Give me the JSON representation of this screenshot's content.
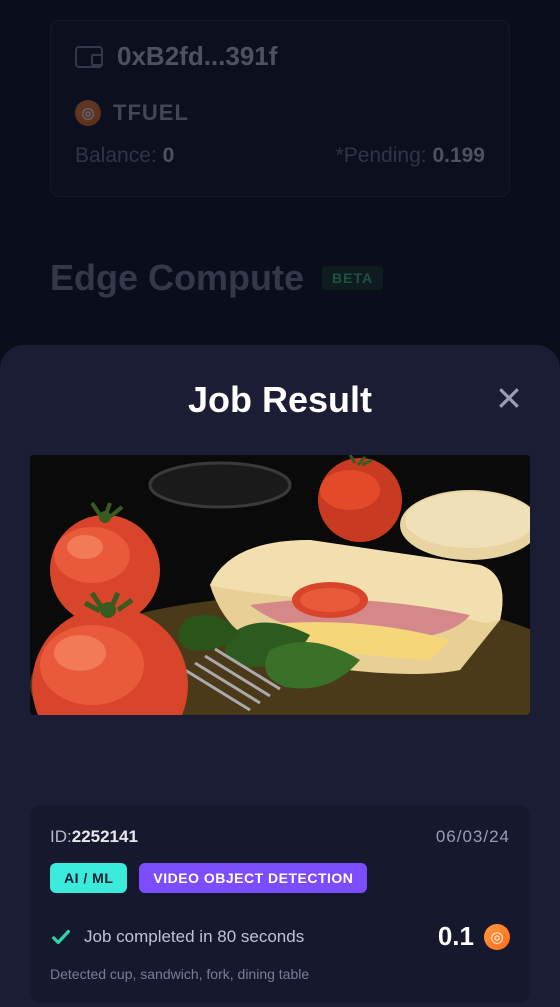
{
  "wallet": {
    "address": "0xB2fd...391f",
    "token_label": "TFUEL",
    "balance_label": "Balance:",
    "balance_value": "0",
    "pending_label": "*Pending:",
    "pending_value": "0.199"
  },
  "section": {
    "title": "Edge Compute",
    "badge": "BETA"
  },
  "modal": {
    "title": "Job Result"
  },
  "job": {
    "id_label": "ID:",
    "id_value": "2252141",
    "date": "06/03/24",
    "tag_aiml": "AI / ML",
    "tag_vod": "VIDEO OBJECT DETECTION",
    "status": "Job completed in 80 seconds",
    "amount": "0.1",
    "detected": "Detected cup, sandwich, fork, dining table"
  }
}
